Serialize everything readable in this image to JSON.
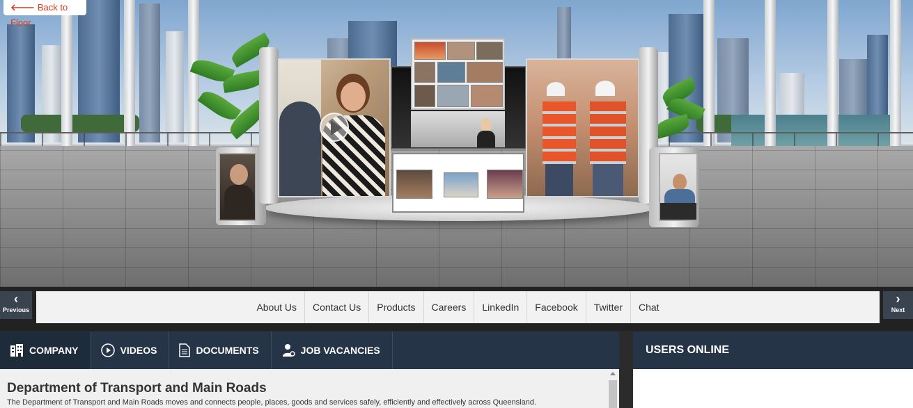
{
  "scene": {
    "back_label": "Back to Floor",
    "back_icon": "arrow-left-icon",
    "accent": "#d93a1a"
  },
  "nav": {
    "previous_label": "Previous",
    "next_label": "Next"
  },
  "links": [
    "About Us",
    "Contact Us",
    "Products",
    "Careers",
    "LinkedIn",
    "Facebook",
    "Twitter",
    "Chat"
  ],
  "tabs": [
    {
      "label": "COMPANY",
      "icon": "building-icon",
      "active": true
    },
    {
      "label": "VIDEOS",
      "icon": "play-circle-icon",
      "active": false
    },
    {
      "label": "DOCUMENTS",
      "icon": "document-icon",
      "active": false
    },
    {
      "label": "JOB VACANCIES",
      "icon": "job-person-icon",
      "active": false
    }
  ],
  "users_online": {
    "title": "USERS ONLINE"
  },
  "company": {
    "title": "Department of Transport and Main Roads",
    "description": "The Department of Transport and Main Roads moves and connects people, places, goods and services safely, efficiently and effectively across Queensland."
  },
  "colors": {
    "tab_bar": "#253547",
    "tab_active": "#1e2b3a",
    "link_bar": "#f2f2f2"
  }
}
